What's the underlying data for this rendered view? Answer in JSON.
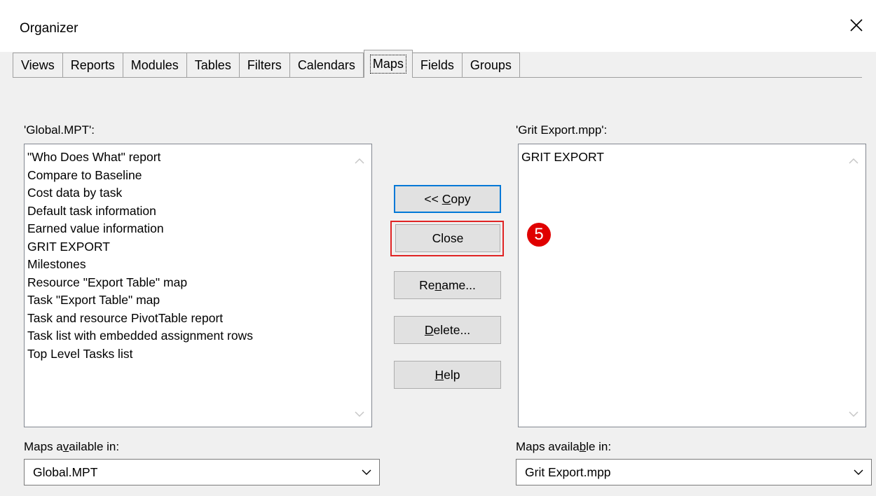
{
  "window": {
    "title": "Organizer",
    "close_icon": "close-icon"
  },
  "tabs": [
    {
      "label": "Views"
    },
    {
      "label": "Reports"
    },
    {
      "label": "Modules"
    },
    {
      "label": "Tables"
    },
    {
      "label": "Filters"
    },
    {
      "label": "Calendars"
    },
    {
      "label": "Maps",
      "active": true
    },
    {
      "label": "Fields"
    },
    {
      "label": "Groups"
    }
  ],
  "left": {
    "heading": "'Global.MPT':",
    "items": [
      "\"Who Does What\" report",
      "Compare to Baseline",
      "Cost data by task",
      "Default task information",
      "Earned value information",
      "GRIT EXPORT",
      "Milestones",
      "Resource \"Export Table\" map",
      "Task \"Export Table\" map",
      "Task and resource PivotTable report",
      "Task list with embedded assignment rows",
      "Top Level Tasks list"
    ],
    "available_label_pre": "Maps a",
    "available_label_key": "v",
    "available_label_post": "ailable in:",
    "available_value": "Global.MPT"
  },
  "right": {
    "heading": "'Grit Export.mpp':",
    "items": [
      "GRIT EXPORT"
    ],
    "available_label_pre": "Maps availa",
    "available_label_key": "b",
    "available_label_post": "le in:",
    "available_value": "Grit Export.mpp"
  },
  "buttons": {
    "copy": {
      "pre": "<< ",
      "key": "C",
      "post": "opy"
    },
    "close": {
      "label": "Close"
    },
    "rename": {
      "pre": "Re",
      "key": "n",
      "post": "ame..."
    },
    "delete": {
      "pre": "",
      "key": "D",
      "post": "elete..."
    },
    "help": {
      "pre": "",
      "key": "H",
      "post": "elp"
    }
  },
  "annotation": {
    "step_number": "5",
    "color": "#e00000"
  },
  "colors": {
    "highlight": "#e02424",
    "default_button_border": "#0078d7",
    "dialog_bg": "#f0f0f0"
  }
}
